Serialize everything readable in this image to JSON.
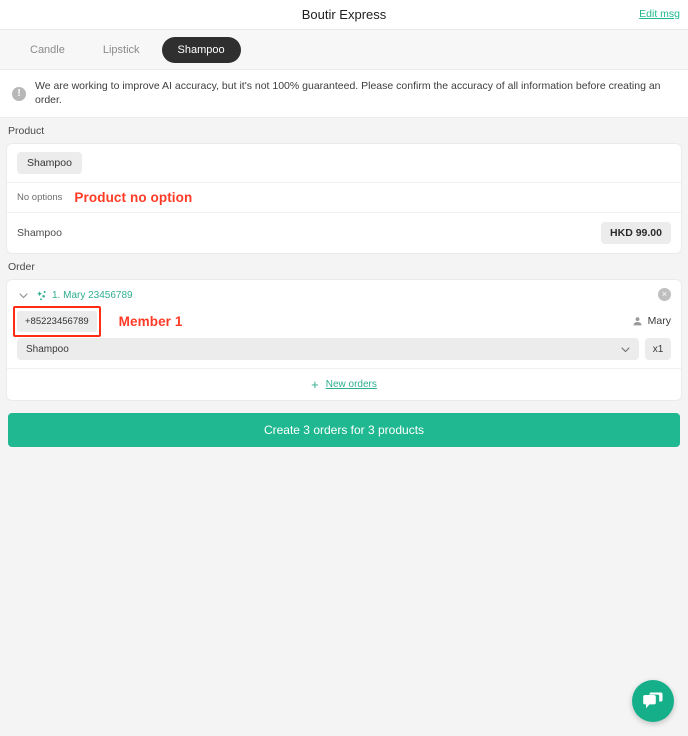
{
  "header": {
    "title": "Boutir Express",
    "edit_link": "Edit msg"
  },
  "tabs": [
    {
      "label": "Candle",
      "active": false
    },
    {
      "label": "Lipstick",
      "active": false
    },
    {
      "label": "Shampoo",
      "active": true
    }
  ],
  "notice": {
    "icon": "info-icon",
    "text": "We are working to improve AI accuracy, but it's not 100% guaranteed. Please confirm the accuracy of all information before creating an order."
  },
  "product_section": {
    "label": "Product",
    "chip": "Shampoo",
    "option_text": "No options",
    "option_annotation": "Product no option",
    "item_name": "Shampoo",
    "item_price": "HKD 99.00"
  },
  "order_section": {
    "label": "Order",
    "order": {
      "title": "1. Mary 23456789",
      "chevron": "chevron-down-icon",
      "ai_icon": "sparkle-icon",
      "close": "×",
      "phone": "+85223456789",
      "phone_annotation": "Member 1",
      "member_icon": "person-icon",
      "member_name": "Mary",
      "product_select_value": "Shampoo",
      "quantity": "x1",
      "new_orders_plus": "+",
      "new_orders_label": "New orders"
    }
  },
  "cta": {
    "label": "Create 3 orders for 3 products"
  },
  "chat": {
    "icon": "chat-bubble-icon"
  },
  "colors": {
    "accent_green": "#1fb890",
    "link_green": "#2fae90",
    "annotation_red": "#ff3b26",
    "redbox_red": "#ff2d14",
    "tab_active_bg": "#2f2f2f",
    "page_bg": "#f4f4f4",
    "chip_bg": "#ececec"
  }
}
